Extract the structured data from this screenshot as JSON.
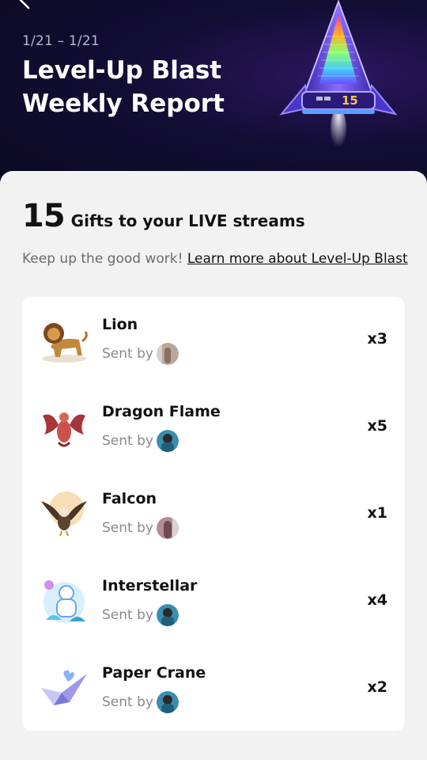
{
  "header": {
    "date_range": "1/21 – 1/21",
    "title": "Level-Up Blast Weekly Report",
    "badge_level": "15"
  },
  "summary": {
    "count": "15",
    "heading": "Gifts to your LIVE streams",
    "subtitle_text": "Keep up the good work! ",
    "learn_more_link": "Learn more about Level-Up Blast"
  },
  "gifts": [
    {
      "name": "Lion",
      "sent_by_label": "Sent by",
      "quantity": "x3",
      "icon": "lion-icon",
      "sender_color": "#b7a89a"
    },
    {
      "name": "Dragon Flame",
      "sent_by_label": "Sent by",
      "quantity": "x5",
      "icon": "dragon-icon",
      "sender_color": "#3a8db0"
    },
    {
      "name": "Falcon",
      "sent_by_label": "Sent by",
      "quantity": "x1",
      "icon": "falcon-icon",
      "sender_color": "#b58c93"
    },
    {
      "name": "Interstellar",
      "sent_by_label": "Sent by",
      "quantity": "x4",
      "icon": "astronaut-icon",
      "sender_color": "#3a8db0"
    },
    {
      "name": "Paper Crane",
      "sent_by_label": "Sent by",
      "quantity": "x2",
      "icon": "paper-crane-icon",
      "sender_color": "#3a8db0"
    }
  ]
}
